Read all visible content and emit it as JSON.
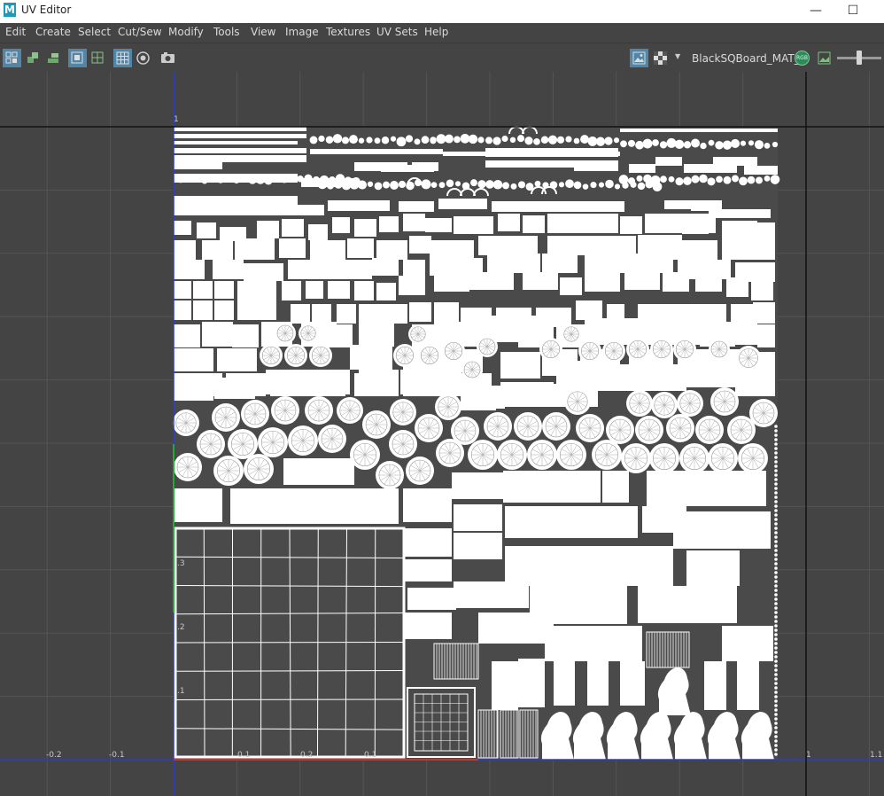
{
  "window": {
    "title": "UV Editor",
    "logo_letter": "M",
    "minimize_glyph": "—",
    "maximize_glyph": "☐"
  },
  "menu": [
    "Edit",
    "Create",
    "Select",
    "Cut/Sew",
    "Modify",
    "Tools",
    "View",
    "Image",
    "Textures",
    "UV Sets",
    "Help"
  ],
  "toolbar": {
    "material_name": "BlackSQBoard_MAT_D",
    "rgb_badge": "RGB",
    "dropdown_glyph": "▼"
  },
  "grid": {
    "x_labels": [
      {
        "text": "-0.2"
      },
      {
        "text": "-0.1"
      },
      {
        "text": "0.1"
      },
      {
        "text": "0.2"
      },
      {
        "text": "0.1"
      },
      {
        "text": "1"
      },
      {
        "text": "1.1"
      }
    ],
    "y_labels": [
      {
        "text": "1"
      },
      {
        "text": ".3"
      },
      {
        "text": ".2"
      },
      {
        "text": ".1"
      }
    ]
  },
  "colors": {
    "background": "#444444",
    "grid_line": "#555555",
    "uv_fill": "#ffffff",
    "axis_blue": "#2a3cc8",
    "axis_green": "#27a83a",
    "axis_red": "#c0392b",
    "selection": "#5285a6"
  }
}
